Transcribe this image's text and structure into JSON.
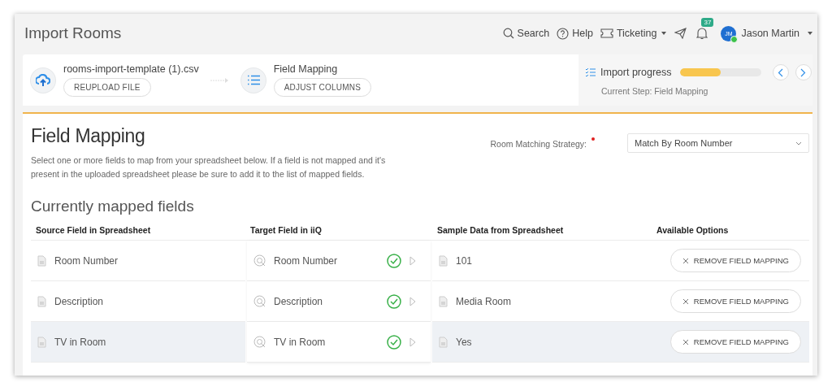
{
  "header": {
    "title": "Import Rooms",
    "nav": [
      {
        "kind": "search",
        "label": "Search"
      },
      {
        "kind": "help",
        "label": "Help"
      },
      {
        "kind": "ticket",
        "label": "Ticketing"
      }
    ],
    "notifications": "37",
    "user": {
      "initials": "JM",
      "name": "Jason Martin",
      "online": true
    }
  },
  "steps": [
    {
      "kind": "upload",
      "title": "rooms-import-template (1).csv",
      "button": "REUPLOAD FILE"
    },
    {
      "kind": "list",
      "title": "Field Mapping",
      "button": "ADJUST COLUMNS"
    }
  ],
  "progress": {
    "label": "Import progress",
    "level": 0.5,
    "current_step": "Current Step: Field Mapping"
  },
  "page": {
    "title": "Field Mapping",
    "description": "Select one or more fields to map from your spreadsheet below. If a field is not mapped and it's present in the uploaded spreadsheet please be sure to add it to the list of mapped fields.",
    "strategy_label": "Room Matching Strategy:",
    "required": true,
    "strategy_value": "Match By Room Number"
  },
  "mapped": {
    "title": "Currently mapped fields",
    "columns": [
      "Source Field in Spreadsheet",
      "Target Field in iiQ",
      "Sample Data from Spreadsheet",
      "Available Options"
    ],
    "rows": [
      {
        "source": "Room Number",
        "target": "Room Number",
        "mapped": true,
        "sample": "101",
        "action": "REMOVE FIELD MAPPING",
        "highlighted": false
      },
      {
        "source": "Description",
        "target": "Description",
        "mapped": true,
        "sample": "Media Room",
        "action": "REMOVE FIELD MAPPING",
        "highlighted": false
      },
      {
        "source": "TV in Room",
        "target": "TV in Room",
        "mapped": true,
        "sample": "Yes",
        "action": "REMOVE FIELD MAPPING",
        "highlighted": true
      }
    ]
  }
}
